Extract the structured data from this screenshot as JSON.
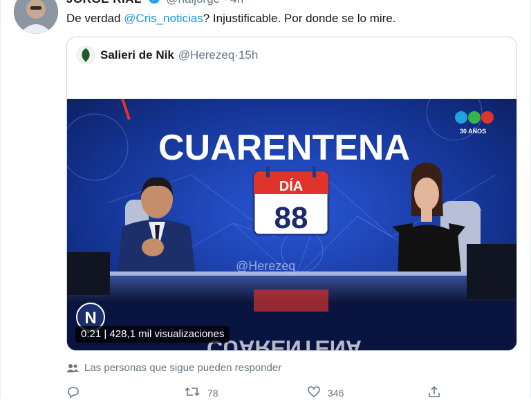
{
  "tweet": {
    "author_name": "JORGE RIAL",
    "author_handle": "@rialjorge",
    "time": "4h",
    "text_prefix": "De verdad ",
    "mention": "@Cris_noticias",
    "text_suffix": "? Injustificable. Por donde se lo mire."
  },
  "quoted": {
    "name": "Salieri de Nik",
    "handle": "@Herezeq",
    "time": "15h",
    "video": {
      "headline": "CUARENTENA",
      "day_label": "DÍA",
      "day_number": "88",
      "channel_badge": "30 AÑOS",
      "watermark": "@Herezeq",
      "reflection_text": "CUARENTENA",
      "duration": "0:21",
      "views": "428,1 mil visualizaciones",
      "brand_letter": "N"
    }
  },
  "replies_note": "Las personas que sigue pueden responder",
  "actions": {
    "retweets": "78",
    "likes": "346"
  },
  "colors": {
    "verified": "#1da1f2",
    "link": "#1b95e0",
    "muted": "#657786",
    "day_red": "#e0332a"
  }
}
